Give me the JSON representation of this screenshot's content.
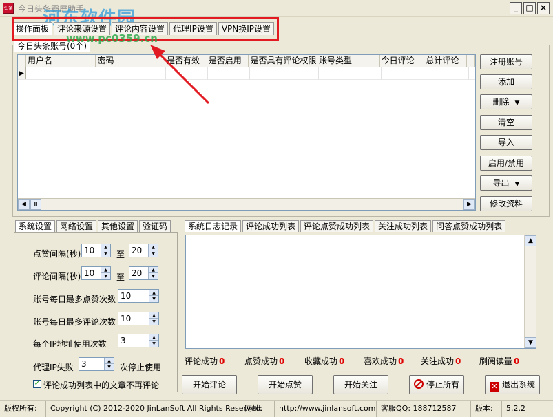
{
  "window": {
    "title": "今日头条霸屏助手",
    "watermark_title": "河东软件园",
    "watermark_url": "www.pc0359.cn",
    "buttons": {
      "minimize": "_",
      "maximize": "□",
      "close": "×"
    }
  },
  "top_tabs": [
    "操作面板",
    "评论来源设置",
    "评论内容设置",
    "代理IP设置",
    "VPN换IP设置"
  ],
  "accounts": {
    "group_title": "今日头条账号(0个)",
    "columns": [
      "用户名",
      "密码",
      "是否有效",
      "是否启用",
      "是否具有评论权限",
      "账号类型",
      "今日评论",
      "总计评论"
    ],
    "rows": []
  },
  "account_buttons": {
    "register": "注册账号",
    "add": "添加",
    "delete": "删除",
    "clear": "清空",
    "import": "导入",
    "toggle": "启用/禁用",
    "export": "导出",
    "edit": "修改资料"
  },
  "settings_tabs": [
    "系统设置",
    "网络设置",
    "其他设置",
    "验证码"
  ],
  "settings": {
    "like_interval_label": "点赞间隔(秒)",
    "like_interval_min": "10",
    "like_interval_max": "20",
    "comment_interval_label": "评论间隔(秒)",
    "comment_interval_min": "10",
    "comment_interval_max": "20",
    "range_to": "至",
    "max_likes_label": "账号每日最多点赞次数",
    "max_likes": "10",
    "max_comments_label": "账号每日最多评论次数",
    "max_comments": "10",
    "ip_uses_label": "每个IP地址使用次数",
    "ip_uses": "3",
    "proxy_fail_label": "代理IP失败",
    "proxy_fail": "3",
    "proxy_fail_suffix": "次停止使用",
    "skip_commented_label": "评论成功列表中的文章不再评论",
    "skip_commented_checked": true
  },
  "log_tabs": [
    "系统日志记录",
    "评论成功列表",
    "评论点赞成功列表",
    "关注成功列表",
    "问答点赞成功列表"
  ],
  "stats": [
    {
      "label": "评论成功",
      "value": "0"
    },
    {
      "label": "点赞成功",
      "value": "0"
    },
    {
      "label": "收藏成功",
      "value": "0"
    },
    {
      "label": "喜欢成功",
      "value": "0"
    },
    {
      "label": "关注成功",
      "value": "0"
    },
    {
      "label": "刷阅读量",
      "value": "0"
    }
  ],
  "action_buttons": {
    "start_comment": "开始评论",
    "start_like": "开始点赞",
    "start_follow": "开始关注",
    "stop_all": "停止所有",
    "exit": "退出系统"
  },
  "status_bar": {
    "copyright_label": "版权所有:",
    "copyright": "Copyright (C) 2012-2020 JinLanSoft All Rights Reserved.",
    "website_label": "网址:",
    "website": "http://www.jinlansoft.com",
    "qq": "客服QQ: 188712587",
    "version_label": "版本:",
    "version": "5.2.2"
  },
  "colors": {
    "highlight": "#e21b23",
    "stat_number": "#e00000",
    "watermark": "#3aa0dc"
  }
}
